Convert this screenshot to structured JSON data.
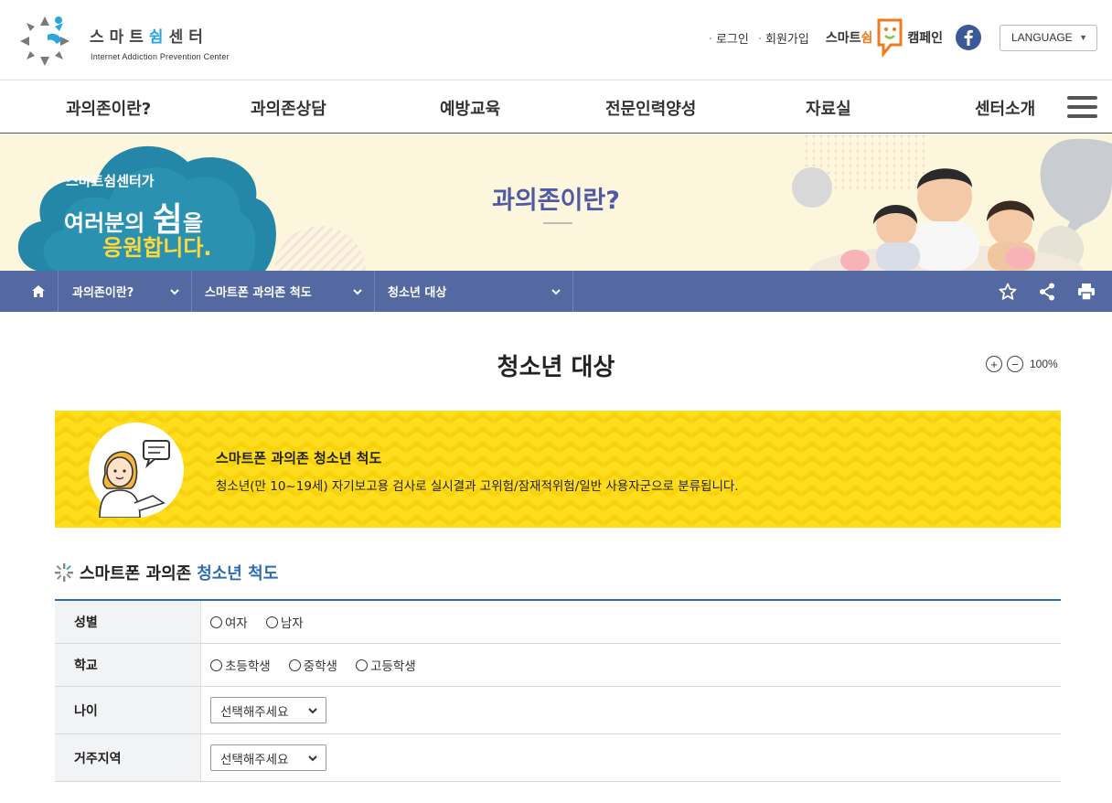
{
  "header": {
    "logo": {
      "text_pre": "스마트",
      "text_hl": "쉼",
      "text_post": "센터",
      "subtitle": "Internet Addiction Prevention Center"
    },
    "util": {
      "login": "로그인",
      "signup": "회원가입"
    },
    "campaign": {
      "text_pre": "스마트",
      "text_hl": "쉼",
      "text_post": "캠페인"
    },
    "language": "LANGUAGE",
    "icons": {
      "facebook": "facebook-icon",
      "menu": "hamburger-menu-icon"
    }
  },
  "gnb": {
    "items": [
      "과의존이란?",
      "과의존상담",
      "예방교육",
      "전문인력양성",
      "자료실",
      "센터소개"
    ]
  },
  "banner": {
    "title": "과의존이란?",
    "cloud_line1": "스마트쉼센터가",
    "cloud_line2_pre": "여러분의 ",
    "cloud_line2_big": "쉼",
    "cloud_line2_post": "을",
    "cloud_line3": "응원합니다."
  },
  "location": {
    "segments": [
      "과의존이란?",
      "스마트폰 과의존 척도",
      "청소년 대상"
    ],
    "tools": [
      "star-icon",
      "share-icon",
      "print-icon"
    ]
  },
  "page": {
    "title": "청소년 대상",
    "zoom": "100%"
  },
  "info": {
    "title": "스마트폰 과의존 청소년 척도",
    "desc": "청소년(만 10~19세) 자기보고용 검사로 실시결과 고위험/잠재적위험/일반 사용자군으로 분류됩니다."
  },
  "section": {
    "title_pre": "스마트폰 과의존",
    "title_hl": "청소년 척도"
  },
  "form": {
    "gender": {
      "label": "성별",
      "options": [
        "여자",
        "남자"
      ]
    },
    "school": {
      "label": "학교",
      "options": [
        "초등학생",
        "중학생",
        "고등학생"
      ]
    },
    "age": {
      "label": "나이",
      "selected": "선택해주세요"
    },
    "region": {
      "label": "거주지역",
      "selected": "선택해주세요"
    }
  },
  "colors": {
    "accent_blue": "#2d6cb5",
    "location_bar": "#5469a1",
    "banner_bg": "#fcf6dc",
    "info_yellow": "#fddd1c",
    "banner_title": "#4e5aa6"
  }
}
